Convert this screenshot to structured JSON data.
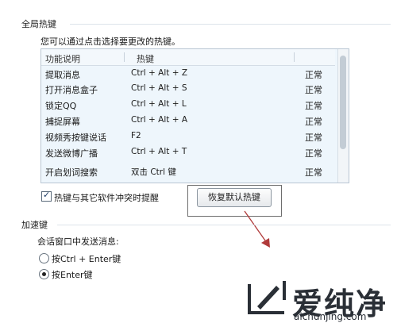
{
  "global_hotkeys": {
    "section_title": "全局热键",
    "description": "您可以通过点击选择要更改的热键。",
    "columns": {
      "function": "功能说明",
      "hotkey": "热键"
    },
    "rows": [
      {
        "function": "提取消息",
        "hotkey": "Ctrl + Alt + Z",
        "status": "正常"
      },
      {
        "function": "打开消息盒子",
        "hotkey": "Ctrl + Alt + S",
        "status": "正常"
      },
      {
        "function": "锁定QQ",
        "hotkey": "Ctrl + Alt + L",
        "status": "正常"
      },
      {
        "function": "捕捉屏幕",
        "hotkey": "Ctrl + Alt + A",
        "status": "正常"
      },
      {
        "function": "视频秀按键说话",
        "hotkey": "F2",
        "status": "正常"
      },
      {
        "function": "发送微博广播",
        "hotkey": "Ctrl + Alt + T",
        "status": "正常"
      },
      {
        "function": "开启划词搜索",
        "hotkey": "双击 Ctrl 键",
        "status": "正常"
      }
    ],
    "conflict_checkbox": {
      "label": "热键与其它软件冲突时提醒",
      "checked": true
    },
    "restore_button": "恢复默认热键"
  },
  "accelerator": {
    "section_title": "加速键",
    "prompt": "会话窗口中发送消息:",
    "options": [
      {
        "label": "按Ctrl + Enter键",
        "selected": false
      },
      {
        "label": "按Enter键",
        "selected": true
      }
    ]
  },
  "watermark": {
    "name": "爱纯净",
    "url": "aichunjing.com"
  },
  "colors": {
    "arrow": "#b03a3a",
    "table_bg": "#eef6fc"
  }
}
